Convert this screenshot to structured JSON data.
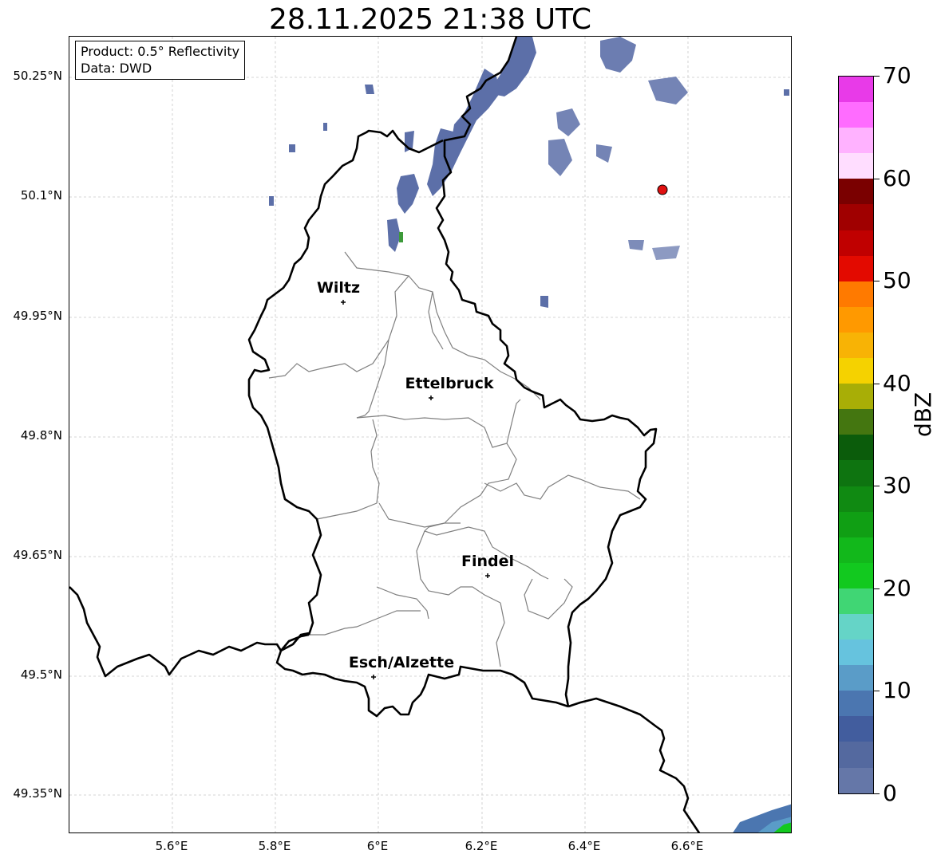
{
  "title": "28.11.2025 21:38 UTC",
  "info": {
    "product": "Product: 0.5° Reflectivity",
    "data": "Data: DWD"
  },
  "lat_labels": [
    "50.25°N",
    "50.1°N",
    "49.95°N",
    "49.8°N",
    "49.65°N",
    "49.5°N",
    "49.35°N"
  ],
  "lon_labels": [
    "5.6°E",
    "5.8°E",
    "6°E",
    "6.2°E",
    "6.4°E",
    "6.6°E"
  ],
  "cities": [
    {
      "name": "Wiltz"
    },
    {
      "name": "Ettelbruck"
    },
    {
      "name": "Findel"
    },
    {
      "name": "Esch/Alzette"
    }
  ],
  "colorbar": {
    "unit": "dBZ",
    "ticks": [
      "0",
      "10",
      "20",
      "30",
      "40",
      "50",
      "60",
      "70"
    ],
    "colors": [
      "#6577a8",
      "#54699f",
      "#425d9e",
      "#4b76b0",
      "#5a9cc8",
      "#66c3de",
      "#65d4c7",
      "#40d674",
      "#12c91f",
      "#12b81b",
      "#109f14",
      "#108a12",
      "#0e7410",
      "#0b5c0b",
      "#447610",
      "#a8ae06",
      "#f5d200",
      "#f8b305",
      "#ff9900",
      "#ff7a00",
      "#e30a00",
      "#c00000",
      "#a00000",
      "#7a0000",
      "#ffddff",
      "#ffb2ff",
      "#ff6cff",
      "#e83ae8"
    ]
  },
  "radar_marker_color": "#e01010"
}
